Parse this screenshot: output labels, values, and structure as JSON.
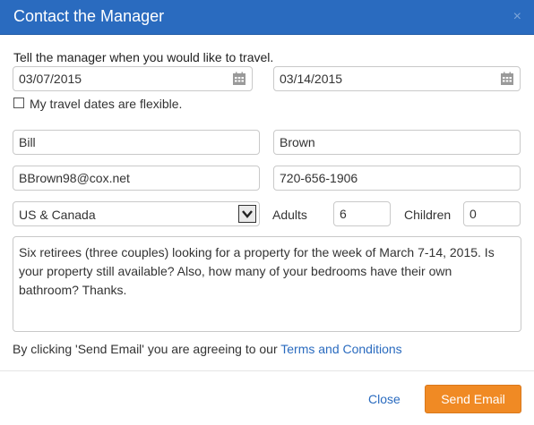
{
  "dialog": {
    "title": "Contact the Manager",
    "close_glyph": "×"
  },
  "form": {
    "intro": "Tell the manager when you would like to travel.",
    "arrival_date": "03/07/2015",
    "departure_date": "03/14/2015",
    "flexible_label": "My travel dates are flexible.",
    "flexible_checked": false,
    "first_name": "Bill",
    "last_name": "Brown",
    "email": "BBrown98@cox.net",
    "phone": "720-656-1906",
    "country": "US & Canada",
    "adults_label": "Adults",
    "adults": "6",
    "children_label": "Children",
    "children": "0",
    "message": "Six retirees (three couples) looking for a property for the week of March 7-14, 2015. Is your property still available? Also, how many of your bedrooms have their own bathroom? Thanks."
  },
  "footer": {
    "terms_prefix": "By clicking 'Send Email' you are agreeing to our ",
    "terms_link": "Terms and Conditions",
    "close_label": "Close",
    "send_label": "Send Email"
  },
  "icons": {
    "calendar": "calendar-icon",
    "dropdown": "chevron-down-icon",
    "close": "close-icon"
  },
  "colors": {
    "header": "#2a6bbf",
    "link": "#2a6bbf",
    "send_button": "#f08a24"
  }
}
